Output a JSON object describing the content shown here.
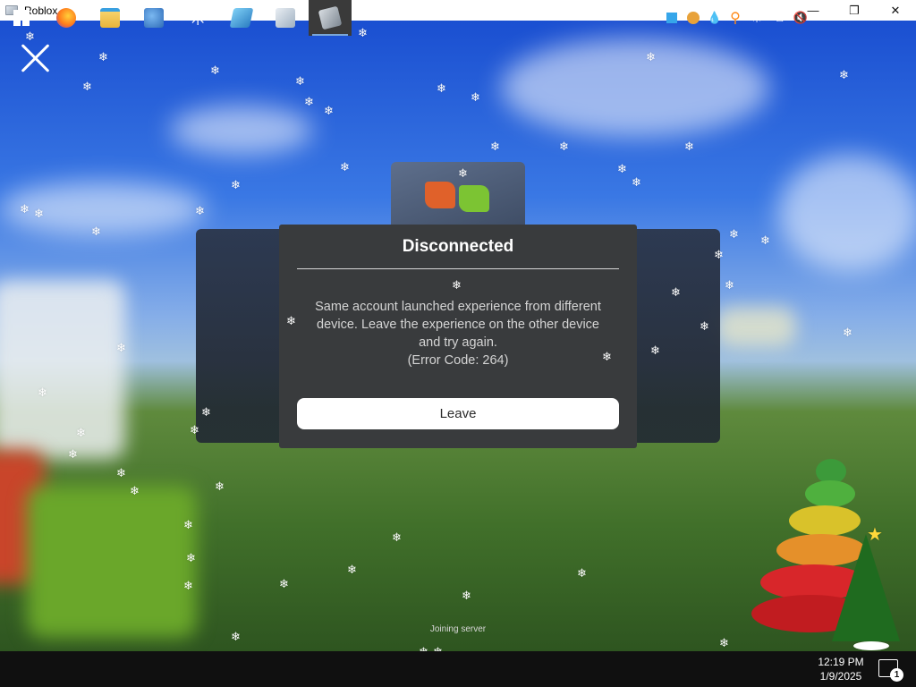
{
  "window": {
    "title": "Roblox",
    "minimize_glyph": "—",
    "restore_glyph": "❐",
    "close_glyph": "✕"
  },
  "dialog": {
    "title": "Disconnected",
    "message_line1": "Same account launched experience from different",
    "message_line2": "device. Leave the experience on the other device",
    "message_line3": "and try again.",
    "error_code": "(Error Code: 264)",
    "leave_label": "Leave"
  },
  "loading": {
    "status": "Joining server"
  },
  "taskbar": {
    "apps": [
      {
        "name": "start-icon"
      },
      {
        "name": "firefox-icon"
      },
      {
        "name": "file-explorer-icon"
      },
      {
        "name": "people-icon"
      },
      {
        "name": "asterisk-app-icon"
      },
      {
        "name": "monitor-app-icon"
      },
      {
        "name": "control-panel-icon"
      },
      {
        "name": "roblox-icon"
      }
    ],
    "clock_time": "12:19 PM",
    "clock_date": "1/9/2025",
    "notification_count": "1"
  },
  "colors": {
    "dialog_bg": "#393b3d",
    "taskbar_bg": "#101010",
    "button_bg": "#ffffff"
  }
}
